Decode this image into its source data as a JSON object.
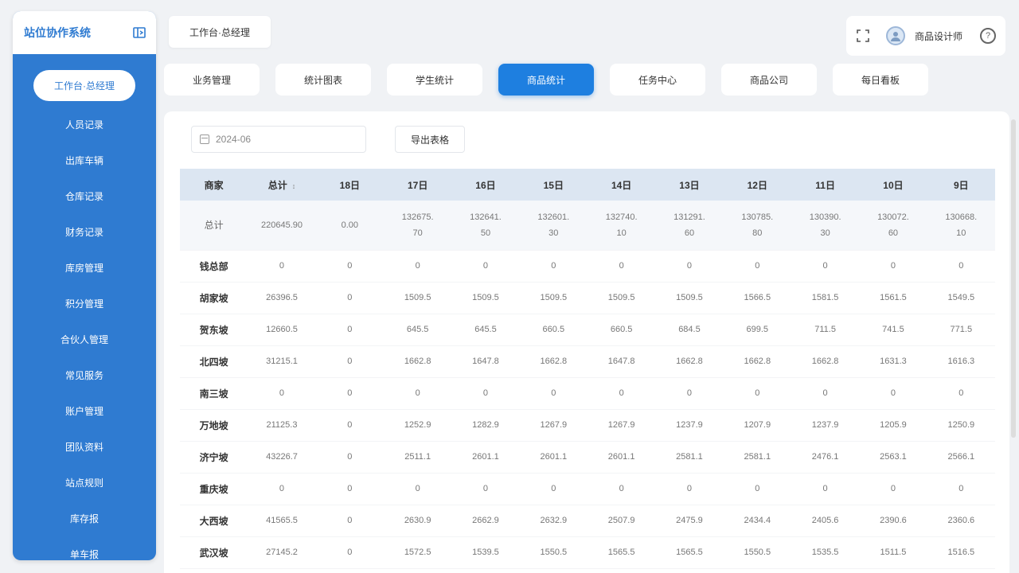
{
  "sidebar": {
    "title": "站位协作系统",
    "items": [
      {
        "label": "工作台·总经理"
      },
      {
        "label": "人员记录"
      },
      {
        "label": "出库车辆"
      },
      {
        "label": "仓库记录"
      },
      {
        "label": "财务记录"
      },
      {
        "label": "库房管理"
      },
      {
        "label": "积分管理"
      },
      {
        "label": "合伙人管理"
      },
      {
        "label": "常见服务"
      },
      {
        "label": "账户管理"
      },
      {
        "label": "团队资料"
      },
      {
        "label": "站点规则"
      },
      {
        "label": "库存报"
      },
      {
        "label": "单车报"
      }
    ]
  },
  "header": {
    "active_tab": "工作台·总经理",
    "user_name": "商品设计师"
  },
  "func_tabs": [
    {
      "label": "业务管理"
    },
    {
      "label": "统计图表"
    },
    {
      "label": "学生统计"
    },
    {
      "label": "商品统计"
    },
    {
      "label": "任务中心"
    },
    {
      "label": "商品公司"
    },
    {
      "label": "每日看板"
    }
  ],
  "toolbar": {
    "date_value": "2024-06",
    "export_label": "导出表格"
  },
  "table": {
    "headers": [
      "商家",
      "总计",
      "18日",
      "17日",
      "16日",
      "15日",
      "14日",
      "13日",
      "12日",
      "11日",
      "10日",
      "9日"
    ],
    "sort_icon": "↕",
    "total": [
      "总计",
      "220645.90",
      "0.00",
      "132675.70",
      "132641.50",
      "132601.30",
      "132740.10",
      "131291.60",
      "130785.80",
      "130390.30",
      "130072.60",
      "130668.10"
    ],
    "rows": [
      [
        "钱总部",
        "0",
        "0",
        "0",
        "0",
        "0",
        "0",
        "0",
        "0",
        "0",
        "0",
        "0"
      ],
      [
        "胡家坡",
        "26396.5",
        "0",
        "1509.5",
        "1509.5",
        "1509.5",
        "1509.5",
        "1509.5",
        "1566.5",
        "1581.5",
        "1561.5",
        "1549.5"
      ],
      [
        "贺东坡",
        "12660.5",
        "0",
        "645.5",
        "645.5",
        "660.5",
        "660.5",
        "684.5",
        "699.5",
        "711.5",
        "741.5",
        "771.5"
      ],
      [
        "北四坡",
        "31215.1",
        "0",
        "1662.8",
        "1647.8",
        "1662.8",
        "1647.8",
        "1662.8",
        "1662.8",
        "1662.8",
        "1631.3",
        "1616.3"
      ],
      [
        "南三坡",
        "0",
        "0",
        "0",
        "0",
        "0",
        "0",
        "0",
        "0",
        "0",
        "0",
        "0"
      ],
      [
        "万地坡",
        "21125.3",
        "0",
        "1252.9",
        "1282.9",
        "1267.9",
        "1267.9",
        "1237.9",
        "1207.9",
        "1237.9",
        "1205.9",
        "1250.9"
      ],
      [
        "济宁坡",
        "43226.7",
        "0",
        "2511.1",
        "2601.1",
        "2601.1",
        "2601.1",
        "2581.1",
        "2581.1",
        "2476.1",
        "2563.1",
        "2566.1"
      ],
      [
        "重庆坡",
        "0",
        "0",
        "0",
        "0",
        "0",
        "0",
        "0",
        "0",
        "0",
        "0",
        "0"
      ],
      [
        "大西坡",
        "41565.5",
        "0",
        "2630.9",
        "2662.9",
        "2632.9",
        "2507.9",
        "2475.9",
        "2434.4",
        "2405.6",
        "2390.6",
        "2360.6"
      ],
      [
        "武汉坡",
        "27145.2",
        "0",
        "1572.5",
        "1539.5",
        "1550.5",
        "1565.5",
        "1565.5",
        "1550.5",
        "1535.5",
        "1511.5",
        "1516.5"
      ]
    ]
  },
  "colors": {
    "primary": "#2f7bd1",
    "active_tab": "#1e7fe0",
    "table_header": "#dce6f2"
  }
}
